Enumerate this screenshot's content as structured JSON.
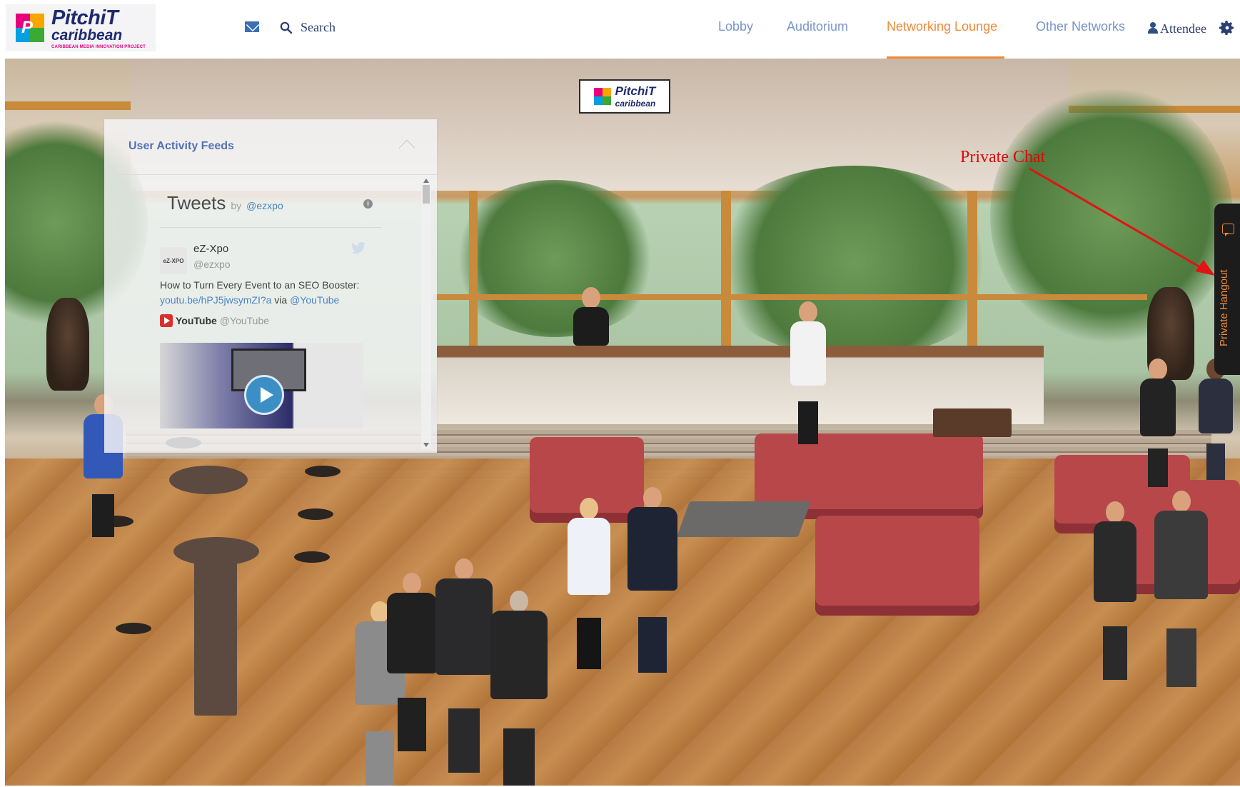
{
  "header": {
    "logo": {
      "title": "PitchiT",
      "subtitle": "caribbean",
      "tagline": "CARIBBEAN MEDIA INNOVATION PROJECT"
    },
    "search_label": "Search",
    "nav": [
      {
        "label": "Lobby",
        "active": false
      },
      {
        "label": "Auditorium",
        "active": false
      },
      {
        "label": "Networking Lounge",
        "active": true
      },
      {
        "label": "Other Networks",
        "active": false
      }
    ],
    "user_label": "Attendee",
    "accent_color": "#ef8a3b",
    "nav_color": "#7a96c8"
  },
  "scene": {
    "banner_logo": {
      "title": "PitchiT",
      "subtitle": "caribbean"
    }
  },
  "feed_panel": {
    "title": "User Activity Feeds",
    "tweets": {
      "heading": "Tweets",
      "by": "by",
      "handle": "@ezxpo",
      "account_name": "eZ-Xpo",
      "account_handle": "@ezxpo",
      "avatar_text": "eZ-XPO",
      "tweet_text": "How to Turn Every Event to an SEO Booster:",
      "tweet_link": "youtu.be/hPJ5jwsymZI?a",
      "tweet_via": "via",
      "tweet_mention": "@YouTube",
      "source_name": "YouTube",
      "source_handle": "@YouTube"
    }
  },
  "annotation": {
    "label": "Private Chat",
    "color": "#d40d0d"
  },
  "hangout_tab": {
    "label": "Private Hangout"
  },
  "icons": {
    "mail": "mail-icon",
    "search": "search-icon",
    "user": "user-icon",
    "settings": "gear-icon",
    "info": "info-icon",
    "twitter": "bird-icon",
    "play": "play-icon",
    "chat": "chat-bubble-icon"
  }
}
